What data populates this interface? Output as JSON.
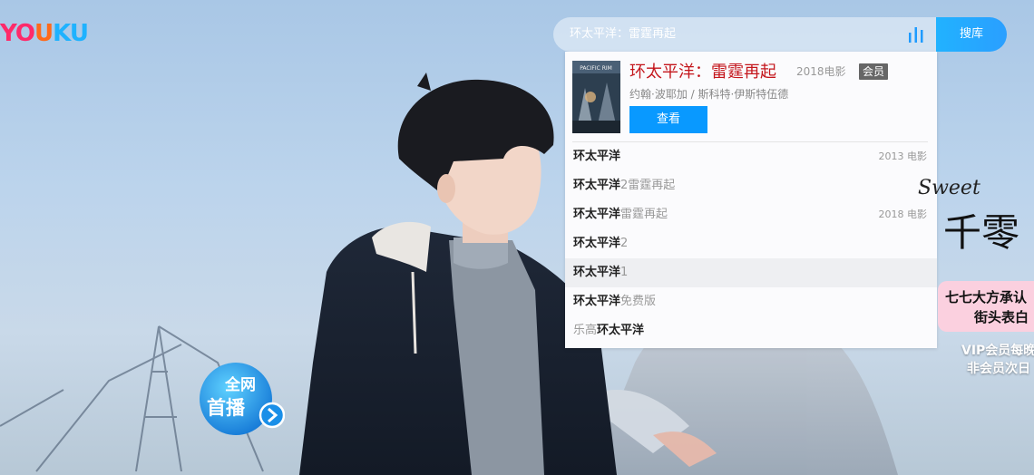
{
  "header": {
    "logo": {
      "part1": "YO",
      "part2": "U",
      "part3": "KU"
    }
  },
  "search": {
    "query": "环太平洋：雷霆再起",
    "button_label": "搜库"
  },
  "featured": {
    "title": "环太平洋：雷霆再起",
    "meta": "2018电影",
    "badge": "会员",
    "cast": "约翰·波耶加 / 斯科特·伊斯特伍德",
    "watch_label": "查看"
  },
  "suggestions": [
    {
      "prefix": "",
      "keyword": "环太平洋",
      "suffix": "",
      "meta": "2013 电影"
    },
    {
      "prefix": "",
      "keyword": "环太平洋",
      "suffix": "2雷霆再起",
      "meta": ""
    },
    {
      "prefix": "",
      "keyword": "环太平洋",
      "suffix": "雷霆再起",
      "meta": "2018 电影"
    },
    {
      "prefix": "",
      "keyword": "环太平洋",
      "suffix": "2",
      "meta": ""
    },
    {
      "prefix": "",
      "keyword": "环太平洋",
      "suffix": "1",
      "meta": ""
    },
    {
      "prefix": "",
      "keyword": "环太平洋",
      "suffix": "免费版",
      "meta": ""
    },
    {
      "prefix": "乐高",
      "keyword": "环太平洋",
      "suffix": "",
      "meta": ""
    }
  ],
  "promo": {
    "sweet": "Sweet",
    "title": "千零",
    "tag_line1": "七七大方承认",
    "tag_line2": "街头表白",
    "vip_line1": "VIP会员每晚",
    "vip_line2": "非会员次日"
  },
  "live_badge": {
    "line1": "全网",
    "line2": "首播"
  },
  "colors": {
    "accent": "#0999ff",
    "title_red": "#c4161c",
    "logo_pink": "#ff2a6a",
    "logo_orange": "#ff6a1a",
    "logo_blue": "#1eb2ff"
  }
}
